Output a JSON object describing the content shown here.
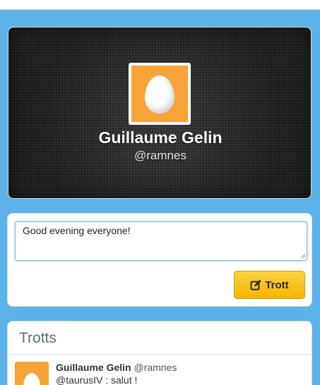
{
  "profile": {
    "name": "Guillaume Gelin",
    "handle": "@ramnes",
    "avatar_icon": "egg-icon",
    "avatar_color": "#f7a338"
  },
  "compose": {
    "value": "Good evening everyone!",
    "button_label": "Trott",
    "button_icon": "edit-icon",
    "button_color": "#f5b400"
  },
  "feed": {
    "title": "Trotts",
    "items": [
      {
        "author": "Guillaume Gelin",
        "handle": "@ramnes",
        "text": "@taurusIV : salut !"
      }
    ]
  },
  "theme": {
    "background": "#5bb3e9"
  }
}
